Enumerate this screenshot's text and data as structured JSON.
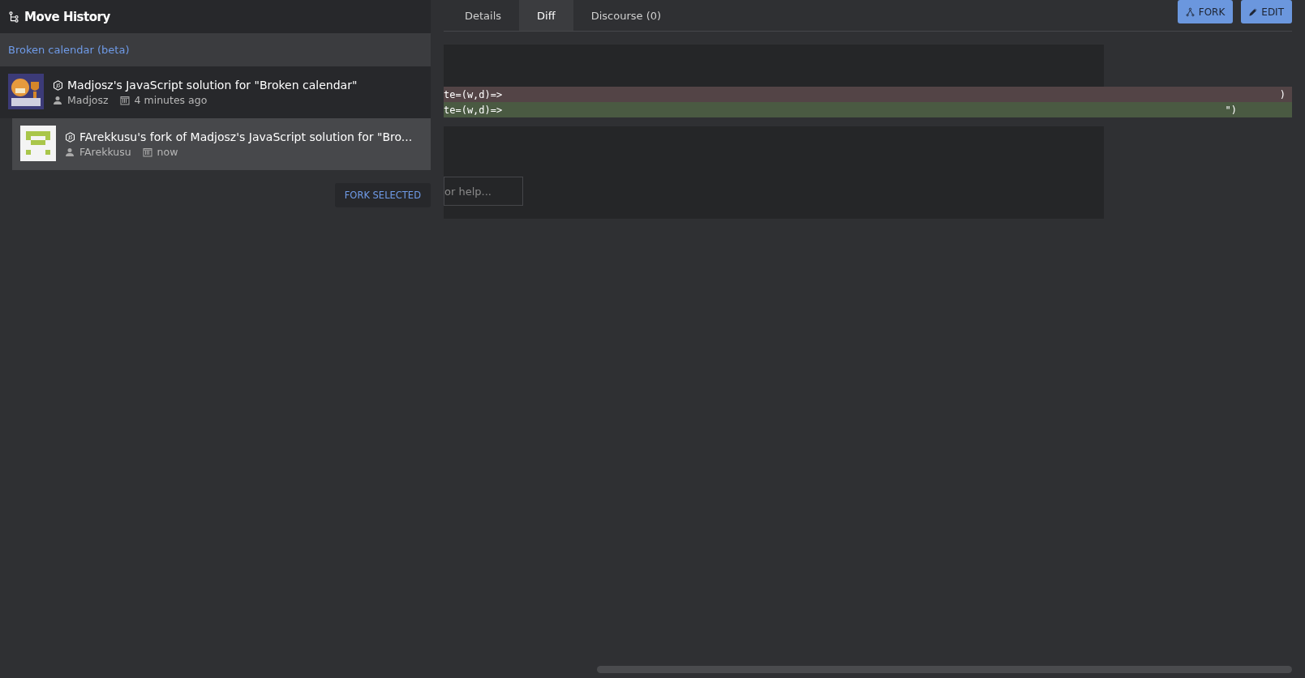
{
  "sidebar": {
    "title": "Move History",
    "kata_link": "Broken calendar (beta)",
    "solutions": [
      {
        "title": "Madjosz's JavaScript solution for \"Broken calendar\"",
        "author": "Madjosz",
        "time": "4 minutes ago",
        "selected": false,
        "children": [
          {
            "title": "FArekkusu's fork of Madjosz's JavaScript solution for \"Bro...",
            "author": "FArekkusu",
            "time": "now",
            "selected": true
          }
        ]
      }
    ],
    "fork_selected": "FORK SELECTED"
  },
  "tabs": [
    {
      "label": "Details",
      "selected": false
    },
    {
      "label": "Diff",
      "selected": true
    },
    {
      "label": "Discourse (0)",
      "selected": false
    }
  ],
  "actions": [
    {
      "label": "FORK",
      "kind": "fork"
    },
    {
      "label": "EDIT",
      "kind": "edit"
    }
  ],
  "diff": [
    {
      "kind": "removed",
      "code": "te=(w,d)=>",
      "end": ")"
    },
    {
      "kind": "added",
      "code": "te=(w,d)=>",
      "end": "\")"
    }
  ],
  "help_field": {
    "placeholder": "or help..."
  }
}
